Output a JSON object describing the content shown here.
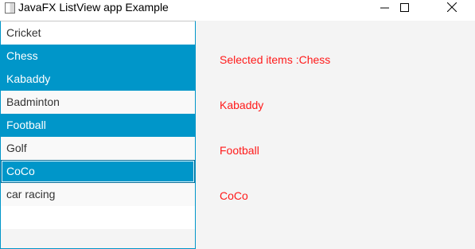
{
  "window": {
    "title": "JavaFX ListView app Example",
    "icons": {
      "app": "java-window-icon",
      "minimize": "minimize-icon",
      "maximize": "maximize-icon",
      "close": "close-icon"
    }
  },
  "list": {
    "items": [
      {
        "label": "Cricket",
        "selected": false
      },
      {
        "label": "Chess",
        "selected": true
      },
      {
        "label": "Kabaddy",
        "selected": true
      },
      {
        "label": "Badminton",
        "selected": false
      },
      {
        "label": "Football",
        "selected": true
      },
      {
        "label": "Golf",
        "selected": false
      },
      {
        "label": "CoCo",
        "selected": true,
        "focused": true
      },
      {
        "label": "car racing",
        "selected": false
      }
    ]
  },
  "output": {
    "lines": [
      "Selected items :Chess",
      "Kabaddy",
      "Football",
      "CoCo"
    ]
  },
  "colors": {
    "selection": "#0096c9",
    "output_text": "#ff1a1a"
  }
}
